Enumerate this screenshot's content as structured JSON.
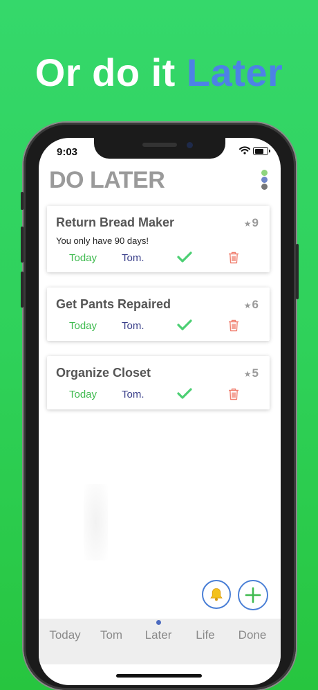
{
  "promo": {
    "lead": "Or do it ",
    "accent": "Later"
  },
  "status_bar": {
    "time": "9:03"
  },
  "header": {
    "title": "DO LATER"
  },
  "tasks": [
    {
      "title": "Return Bread Maker",
      "stars": "9",
      "note": "You only have 90 days!",
      "today_label": "Today",
      "tom_label": "Tom."
    },
    {
      "title": "Get Pants Repaired",
      "stars": "6",
      "today_label": "Today",
      "tom_label": "Tom."
    },
    {
      "title": "Organize Closet",
      "stars": "5",
      "today_label": "Today",
      "tom_label": "Tom."
    }
  ],
  "tabs": [
    {
      "label": "Today"
    },
    {
      "label": "Tom"
    },
    {
      "label": "Later",
      "active": true
    },
    {
      "label": "Life"
    },
    {
      "label": "Done"
    }
  ],
  "icons": {
    "star": "star-icon",
    "check": "check-icon",
    "trash": "trash-icon",
    "bell": "bell-icon",
    "add": "plus-icon"
  },
  "colors": {
    "background_green": "#2fd15a",
    "accent_blue": "#4d82e6",
    "today_green": "#3fba4f",
    "tom_navy": "#3a3f8a",
    "check_green": "#4ccf73",
    "trash_red": "#f08070",
    "title_gray": "#9a9a9a",
    "menu_dots": [
      "#8fd57e",
      "#6f86c9",
      "#777777"
    ]
  }
}
